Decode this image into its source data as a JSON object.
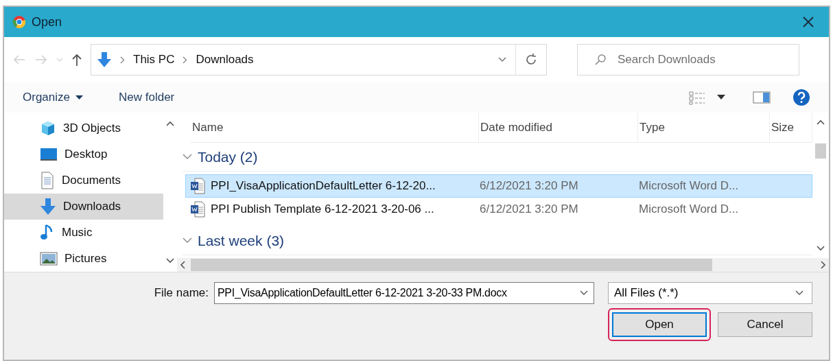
{
  "window": {
    "title": "Open"
  },
  "nav": {
    "path": [
      "This PC",
      "Downloads"
    ]
  },
  "search": {
    "placeholder": "Search Downloads"
  },
  "toolbar": {
    "organize": "Organize",
    "new_folder": "New folder"
  },
  "sidebar": {
    "items": [
      {
        "label": "3D Objects",
        "selected": false
      },
      {
        "label": "Desktop",
        "selected": false
      },
      {
        "label": "Documents",
        "selected": false
      },
      {
        "label": "Downloads",
        "selected": true
      },
      {
        "label": "Music",
        "selected": false
      },
      {
        "label": "Pictures",
        "selected": false
      }
    ]
  },
  "table": {
    "columns": [
      "Name",
      "Date modified",
      "Type",
      "Size"
    ],
    "groups": [
      {
        "label": "Today (2)",
        "expanded": true,
        "rows": [
          {
            "name": "PPI_VisaApplicationDefaultLetter 6-12-20...",
            "date": "6/12/2021 3:20 PM",
            "type": "Microsoft Word D...",
            "selected": true
          },
          {
            "name": "PPI Publish Template 6-12-2021 3-20-06 ...",
            "date": "6/12/2021 3:20 PM",
            "type": "Microsoft Word D...",
            "selected": false
          }
        ]
      },
      {
        "label": "Last week (3)",
        "expanded": true
      }
    ]
  },
  "footer": {
    "file_name_label": "File name:",
    "file_name": "PPI_VisaApplicationDefaultLetter 6-12-2021 3-20-33 PM.docx",
    "filter": "All Files (*.*)",
    "buttons": [
      {
        "label": "Open",
        "kind": "primary",
        "highlighted": true
      },
      {
        "label": "Cancel",
        "kind": "secondary",
        "highlighted": false
      }
    ]
  }
}
